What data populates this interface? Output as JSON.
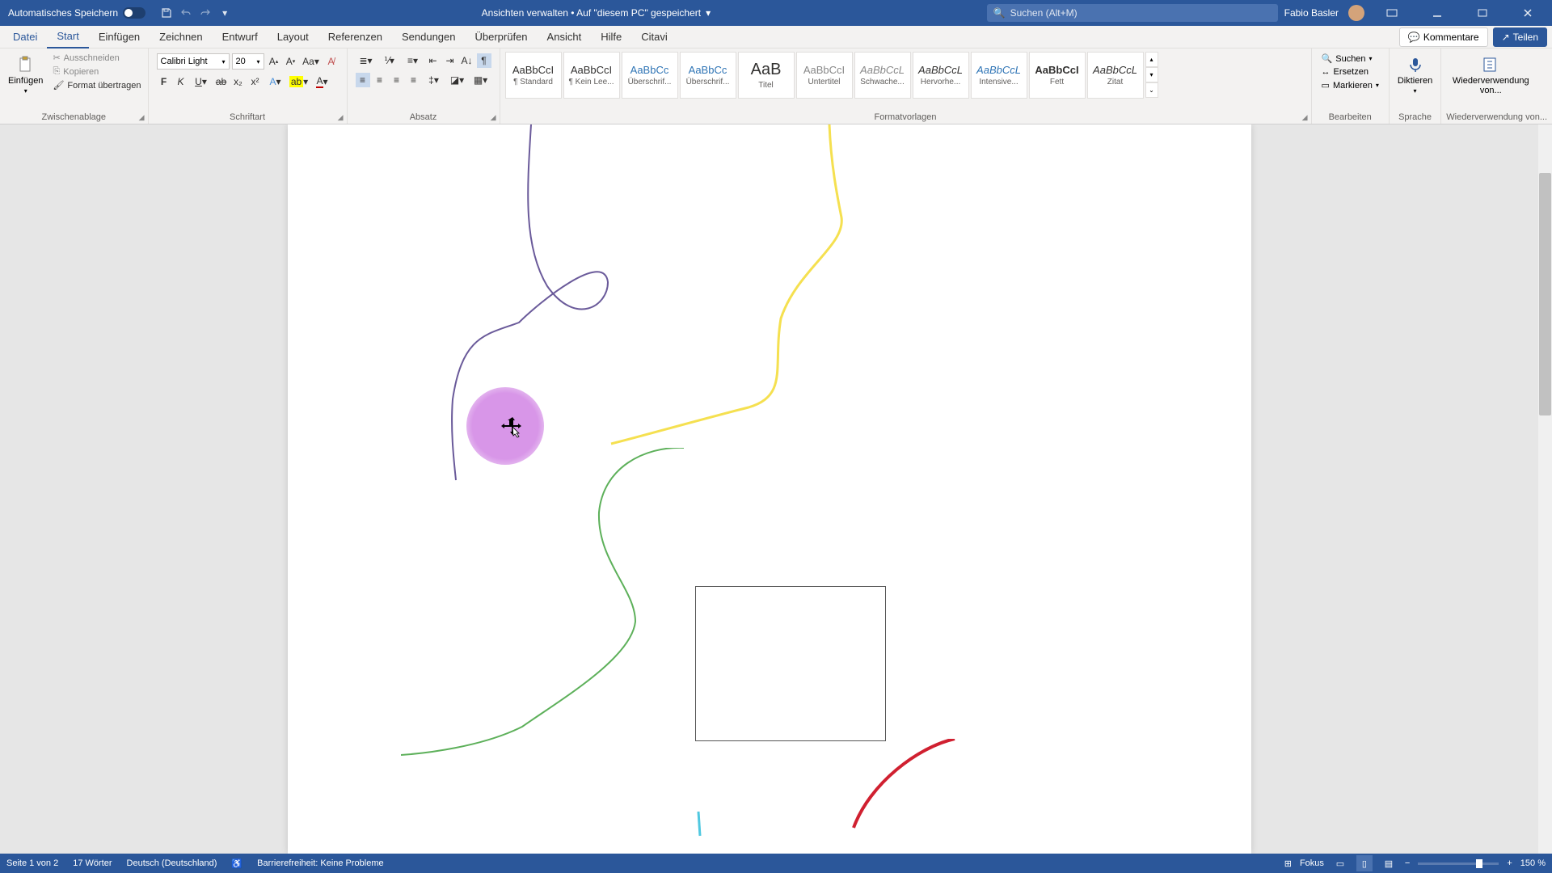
{
  "titlebar": {
    "autosave": "Automatisches Speichern",
    "doc_title": "Ansichten verwalten • Auf \"diesem PC\" gespeichert",
    "search_placeholder": "Suchen (Alt+M)",
    "user": "Fabio Basler"
  },
  "tabs": {
    "file": "Datei",
    "start": "Start",
    "insert": "Einfügen",
    "draw": "Zeichnen",
    "design": "Entwurf",
    "layout": "Layout",
    "references": "Referenzen",
    "mailings": "Sendungen",
    "review": "Überprüfen",
    "view": "Ansicht",
    "help": "Hilfe",
    "citavi": "Citavi",
    "comments": "Kommentare",
    "share": "Teilen"
  },
  "ribbon": {
    "clipboard": {
      "paste": "Einfügen",
      "cut": "Ausschneiden",
      "copy": "Kopieren",
      "format_painter": "Format übertragen",
      "label": "Zwischenablage"
    },
    "font": {
      "name": "Calibri Light",
      "size": "20",
      "label": "Schriftart"
    },
    "paragraph": {
      "label": "Absatz"
    },
    "styles": {
      "label": "Formatvorlagen",
      "items": [
        {
          "sample": "AaBbCcI",
          "name": "¶ Standard"
        },
        {
          "sample": "AaBbCcI",
          "name": "¶ Kein Lee..."
        },
        {
          "sample": "AaBbCc",
          "name": "Überschrif..."
        },
        {
          "sample": "AaBbCc",
          "name": "Überschrif..."
        },
        {
          "sample": "AaB",
          "name": "Titel"
        },
        {
          "sample": "AaBbCcI",
          "name": "Untertitel"
        },
        {
          "sample": "AaBbCcL",
          "name": "Schwache..."
        },
        {
          "sample": "AaBbCcL",
          "name": "Hervorhe..."
        },
        {
          "sample": "AaBbCcL",
          "name": "Intensive..."
        },
        {
          "sample": "AaBbCcI",
          "name": "Fett"
        },
        {
          "sample": "AaBbCcL",
          "name": "Zitat"
        }
      ]
    },
    "editing": {
      "find": "Suchen",
      "replace": "Ersetzen",
      "select": "Markieren",
      "label": "Bearbeiten"
    },
    "dictate": {
      "btn": "Diktieren",
      "label": "Sprache"
    },
    "reuse": {
      "btn": "Wiederverwendung von...",
      "label": "Wiederverwendung von..."
    }
  },
  "statusbar": {
    "page": "Seite 1 von 2",
    "words": "17 Wörter",
    "language": "Deutsch (Deutschland)",
    "accessibility": "Barrierefreiheit: Keine Probleme",
    "focus": "Fokus",
    "zoom": "150 %"
  }
}
